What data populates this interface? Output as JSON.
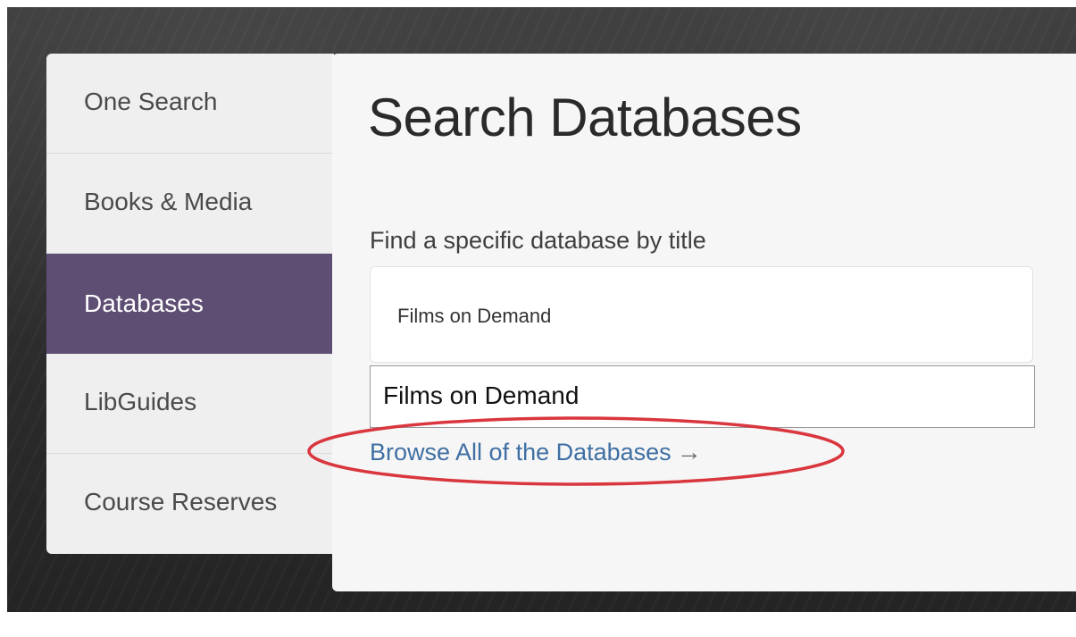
{
  "nav": {
    "items": [
      {
        "label": "One Search"
      },
      {
        "label": "Books & Media"
      },
      {
        "label": "Databases"
      },
      {
        "label": "LibGuides"
      },
      {
        "label": "Course Reserves"
      }
    ],
    "active": "Databases"
  },
  "main": {
    "title": "Search Databases",
    "field_label": "Find a specific database by title",
    "input_value": "Films on Demand",
    "suggestion": "Films on Demand",
    "browse_link": "Browse All of the Databases",
    "browse_arrow": "→"
  },
  "colors": {
    "active_nav": "#5e4e73",
    "link": "#3f6fa3",
    "annotation": "#d9363e"
  }
}
